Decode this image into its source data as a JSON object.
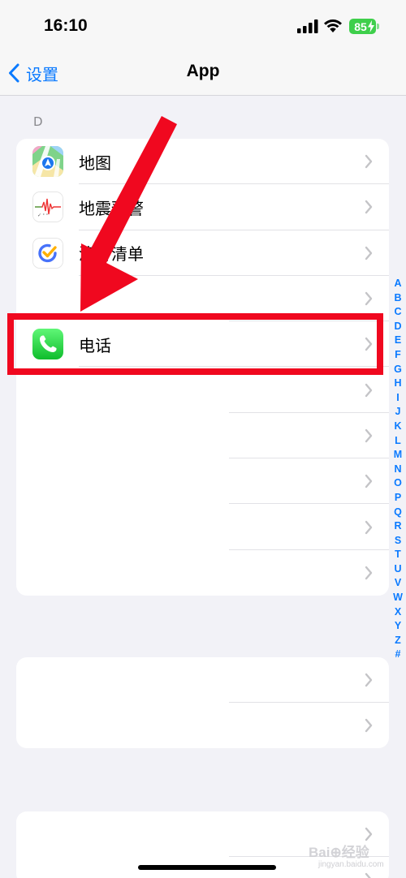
{
  "status_bar": {
    "time": "16:10",
    "battery_level": "85",
    "icons": [
      "signal-icon",
      "wifi-icon",
      "battery-charging-icon"
    ]
  },
  "nav": {
    "back_label": "设置",
    "title": "App"
  },
  "section_d": {
    "header": "D",
    "rows": [
      {
        "label": "地图",
        "icon": "maps-app-icon"
      },
      {
        "label": "地震预警",
        "icon": "earthquake-alert-app-icon"
      },
      {
        "label": "滴答清单",
        "icon": "ticktick-app-icon"
      },
      {
        "label": ""
      },
      {
        "label": "电话",
        "icon": "phone-app-icon"
      },
      {
        "label": ""
      },
      {
        "label": ""
      },
      {
        "label": ""
      },
      {
        "label": ""
      },
      {
        "label": ""
      }
    ]
  },
  "group_2": {
    "rows": [
      {
        "label": ""
      },
      {
        "label": ""
      }
    ]
  },
  "group_3": {
    "rows": [
      {
        "label": ""
      },
      {
        "label": ""
      }
    ]
  },
  "alpha_index": [
    "A",
    "B",
    "C",
    "D",
    "E",
    "F",
    "G",
    "H",
    "I",
    "J",
    "K",
    "L",
    "M",
    "N",
    "O",
    "P",
    "Q",
    "R",
    "S",
    "T",
    "U",
    "V",
    "W",
    "X",
    "Y",
    "Z",
    "#"
  ],
  "watermark": {
    "text": "Bai⊕经验",
    "sub": "jingyan.baidu.com"
  },
  "colors": {
    "accent": "#0a7aff",
    "battery": "#3ecf4b",
    "annotation_red": "#f0081f",
    "phone_green": "#34c759"
  }
}
